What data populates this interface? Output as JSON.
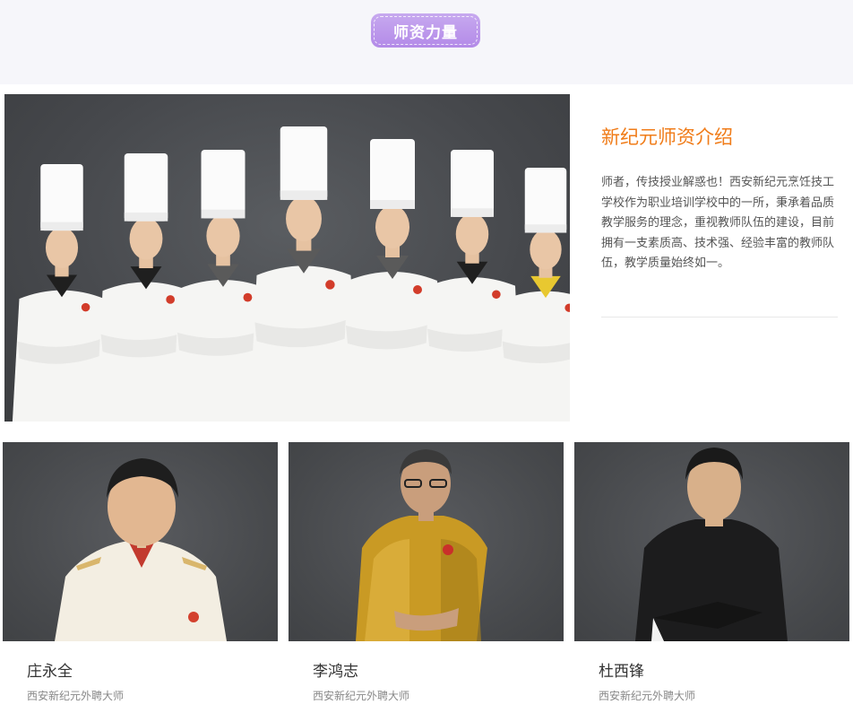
{
  "section": {
    "badge": "师资力量"
  },
  "intro": {
    "title": "新纪元师资介绍",
    "text": "师者，传技授业解惑也！西安新纪元烹饪技工学校作为职业培训学校中的一所，秉承着品质教学服务的理念，重视教师队伍的建设，目前拥有一支素质高、技术强、经验丰富的教师队伍，教学质量始终如一。"
  },
  "teachers": [
    {
      "name": "庄永全",
      "role": "西安新纪元外聘大师"
    },
    {
      "name": "李鸿志",
      "role": "西安新纪元外聘大师"
    },
    {
      "name": "杜西锋",
      "role": "西安新纪元外聘大师"
    }
  ],
  "colors": {
    "badge": "#b38ae8",
    "title": "#f07c19",
    "photo_bg": "#47494c"
  }
}
